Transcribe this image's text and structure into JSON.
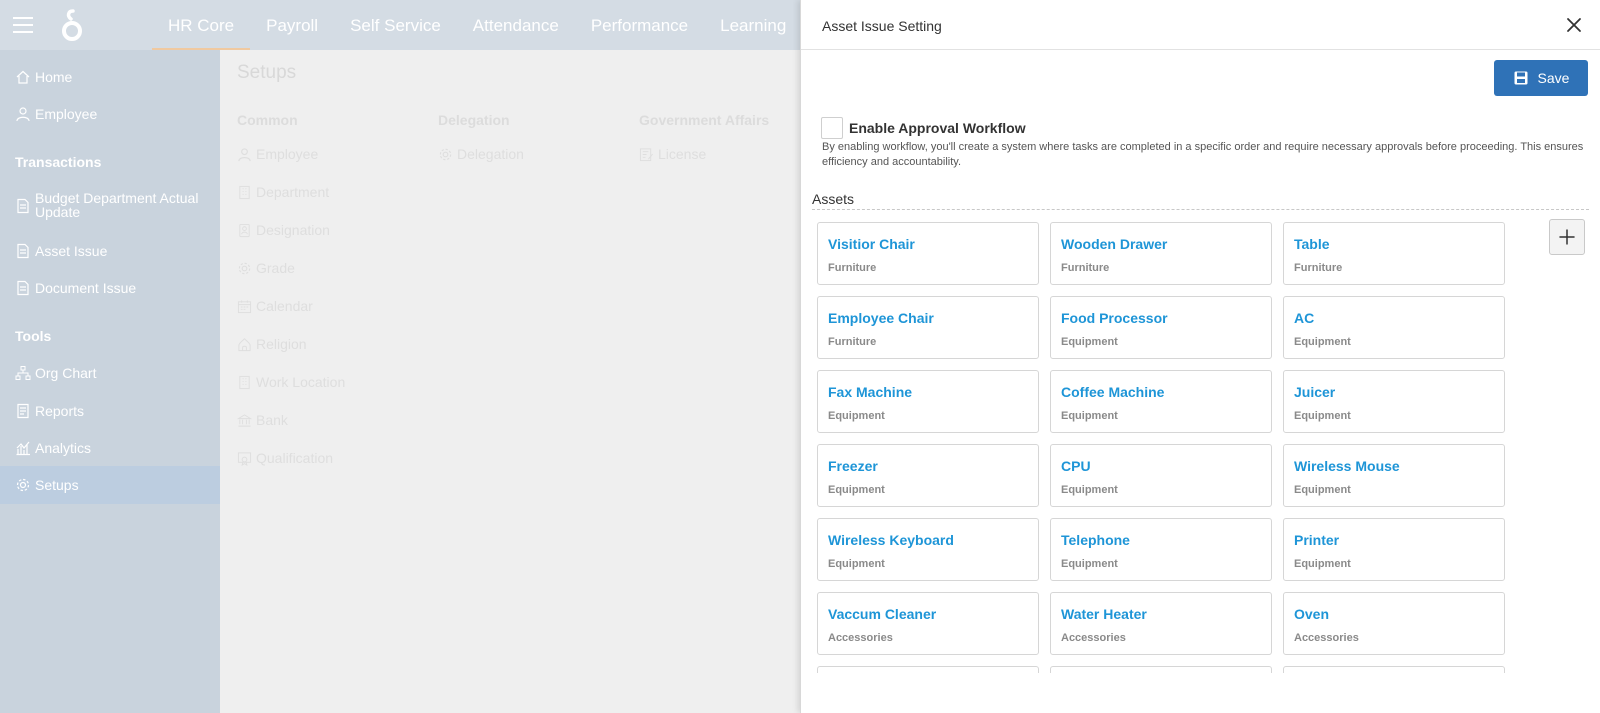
{
  "topnav": {
    "items": [
      {
        "label": "HR Core",
        "active": true
      },
      {
        "label": "Payroll"
      },
      {
        "label": "Self Service"
      },
      {
        "label": "Attendance"
      },
      {
        "label": "Performance"
      },
      {
        "label": "Learning"
      }
    ]
  },
  "sidebar": {
    "home": "Home",
    "employee": "Employee",
    "transactions_heading": "Transactions",
    "budget_line1": "Budget Department Actual",
    "budget_line2": "Update",
    "asset_issue": "Asset Issue",
    "document_issue": "Document Issue",
    "tools_heading": "Tools",
    "org_chart": "Org Chart",
    "reports": "Reports",
    "analytics": "Analytics",
    "setups": "Setups"
  },
  "setups": {
    "title": "Setups",
    "common": {
      "heading": "Common",
      "items": [
        "Employee",
        "Department",
        "Designation",
        "Grade",
        "Calendar",
        "Religion",
        "Work Location",
        "Bank",
        "Qualification"
      ]
    },
    "delegation": {
      "heading": "Delegation",
      "items": [
        "Delegation"
      ]
    },
    "government": {
      "heading": "Government Affairs",
      "items": [
        "License"
      ]
    }
  },
  "panel": {
    "title": "Asset Issue Setting",
    "save_label": "Save",
    "workflow_label": "Enable Approval Workflow",
    "workflow_checked": false,
    "workflow_desc": "By enabling workflow, you'll create a system where tasks are completed in a specific order and require necessary approvals before proceeding. This ensures efficiency and accountability.",
    "assets_title": "Assets",
    "assets": [
      {
        "name": "Visitior Chair",
        "category": "Furniture"
      },
      {
        "name": "Wooden Drawer",
        "category": "Furniture"
      },
      {
        "name": "Table",
        "category": "Furniture"
      },
      {
        "name": "Employee Chair",
        "category": "Furniture"
      },
      {
        "name": "Food Processor",
        "category": "Equipment"
      },
      {
        "name": "AC",
        "category": "Equipment"
      },
      {
        "name": "Fax Machine",
        "category": "Equipment"
      },
      {
        "name": "Coffee Machine",
        "category": "Equipment"
      },
      {
        "name": "Juicer",
        "category": "Equipment"
      },
      {
        "name": "Freezer",
        "category": "Equipment"
      },
      {
        "name": "CPU",
        "category": "Equipment"
      },
      {
        "name": "Wireless Mouse",
        "category": "Equipment"
      },
      {
        "name": "Wireless Keyboard",
        "category": "Equipment"
      },
      {
        "name": "Telephone",
        "category": "Equipment"
      },
      {
        "name": "Printer",
        "category": "Equipment"
      },
      {
        "name": "Vaccum Cleaner",
        "category": "Accessories"
      },
      {
        "name": "Water Heater",
        "category": "Accessories"
      },
      {
        "name": "Oven",
        "category": "Accessories"
      }
    ]
  },
  "colors": {
    "accent": "#2f72b7",
    "asset_link": "#1e95d7",
    "nav_bg": "#d4dce4",
    "sidebar_bg": "#c9d3dd"
  }
}
